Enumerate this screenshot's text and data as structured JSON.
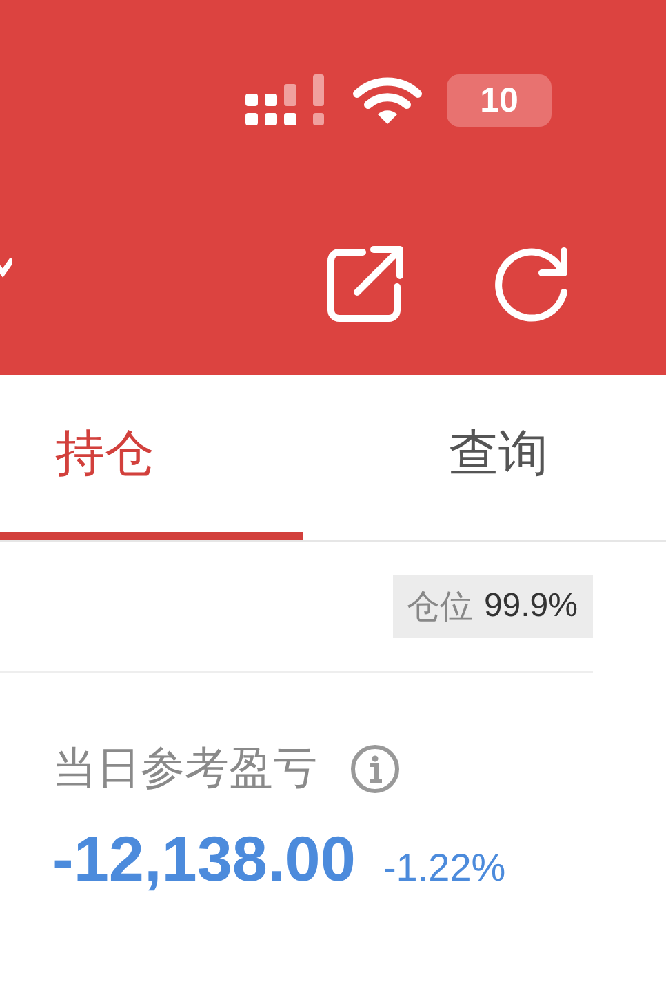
{
  "status_bar": {
    "battery": "10"
  },
  "tabs": [
    {
      "label": "持仓",
      "selected": true
    },
    {
      "label": "查询",
      "selected": false
    }
  ],
  "position": {
    "label": "仓位",
    "value": "99.9%"
  },
  "daily_pnl": {
    "label": "当日参考盈亏",
    "amount": "-12,138.00",
    "percent": "-1.22%"
  }
}
